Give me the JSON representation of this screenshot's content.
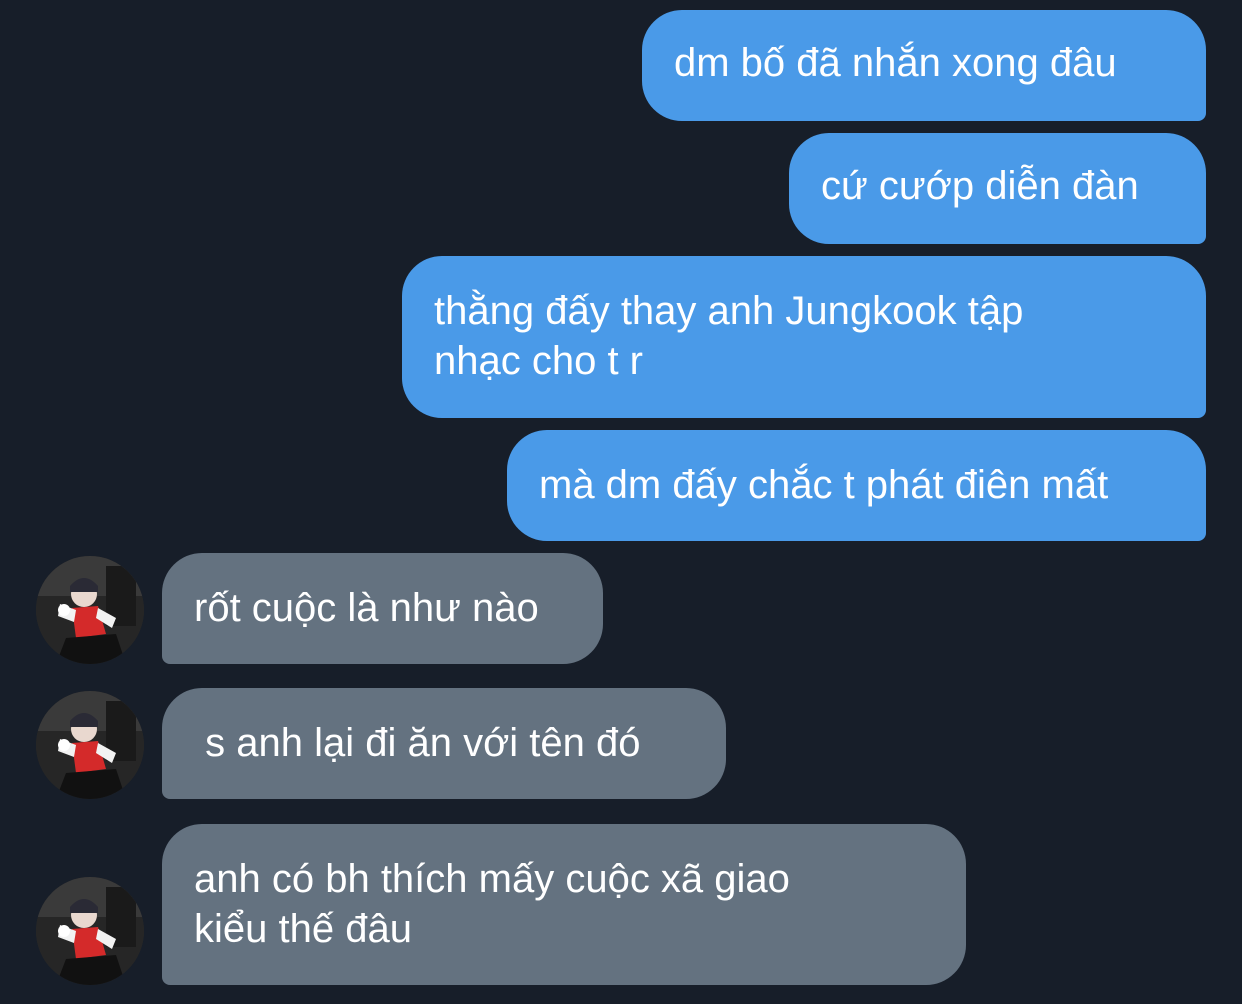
{
  "chat": {
    "sent_messages": [
      {
        "text": "dm bố đã nhắn xong đâu"
      },
      {
        "text": "cứ cướp diễn đàn"
      },
      {
        "text": "thằng đấy thay anh Jungkook tập\nnhạc cho t r"
      },
      {
        "text": "mà dm đấy chắc t phát điên mất"
      }
    ],
    "received_messages": [
      {
        "text": "rốt cuộc là như nào"
      },
      {
        "text": " s anh lại đi ăn với tên đó"
      },
      {
        "text": "anh có bh thích mấy cuộc xã giao\nkiểu thế đâu"
      }
    ],
    "avatar_icon": "profile-photo",
    "colors": {
      "background": "#171e29",
      "sent_bubble": "#4a9ae8",
      "received_bubble": "#647280",
      "text": "#ffffff"
    }
  }
}
